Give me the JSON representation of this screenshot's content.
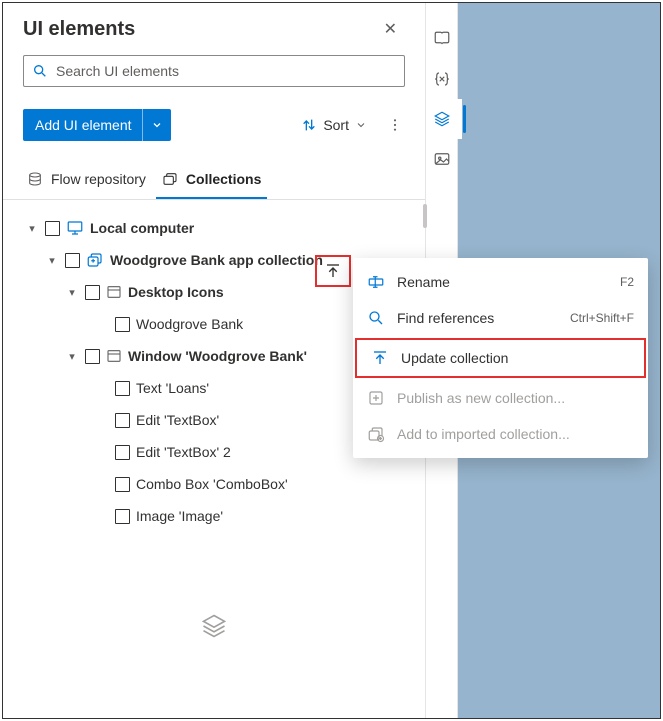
{
  "header": {
    "title": "UI elements"
  },
  "search": {
    "placeholder": "Search UI elements"
  },
  "toolbar": {
    "add_label": "Add UI element",
    "sort_label": "Sort"
  },
  "tabs": {
    "flow_repo": "Flow repository",
    "collections": "Collections"
  },
  "tree": {
    "root": {
      "label": "Local computer"
    },
    "collection": {
      "label": "Woodgrove Bank app collection"
    },
    "group1": {
      "label": "Desktop Icons"
    },
    "leaf1": {
      "label": "Woodgrove Bank"
    },
    "group2": {
      "label": "Window 'Woodgrove Bank'"
    },
    "leaves2": [
      {
        "label": "Text 'Loans'"
      },
      {
        "label": "Edit 'TextBox'"
      },
      {
        "label": "Edit 'TextBox' 2"
      },
      {
        "label": "Combo Box 'ComboBox'"
      },
      {
        "label": "Image 'Image'"
      }
    ]
  },
  "context_menu": {
    "rename": {
      "label": "Rename",
      "kb": "F2"
    },
    "find_refs": {
      "label": "Find references",
      "kb": "Ctrl+Shift+F"
    },
    "update": {
      "label": "Update collection"
    },
    "publish": {
      "label": "Publish as new collection..."
    },
    "add_imported": {
      "label": "Add to imported collection..."
    }
  }
}
